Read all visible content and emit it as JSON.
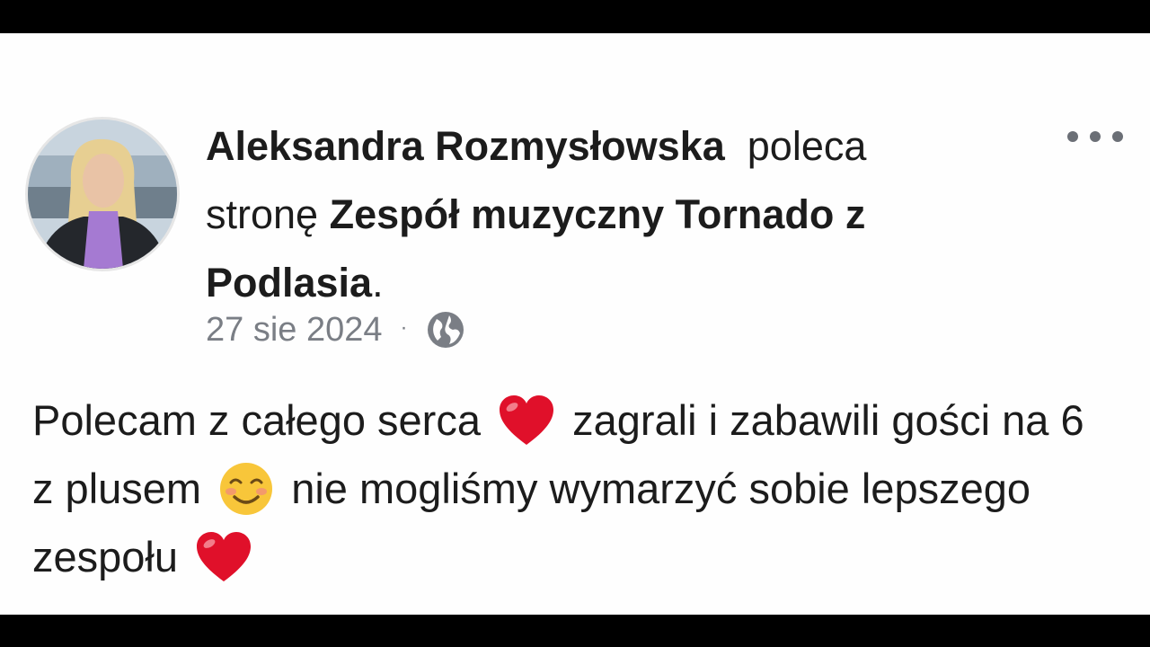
{
  "post": {
    "author": "Aleksandra Rozmysłowska",
    "action_text": "poleca",
    "page_prefix": "stronę",
    "page_name": "Zespół muzyczny Tornado z Podlasia",
    "page_suffix": ".",
    "date": "27 sie 2024",
    "separator": "·",
    "privacy_icon": "globe-icon",
    "more_icon": "more-options-icon",
    "body": {
      "part1": "Polecam z całego serca",
      "emoji1": "red-heart",
      "part2": "zagrali i zabawili gości na 6 z plusem",
      "emoji2": "smiling-face-with-blush",
      "part3": "nie mogliśmy wymarzyć sobie lepszego zespołu",
      "emoji3": "red-heart"
    }
  },
  "colors": {
    "background": "#fefefe",
    "text": "#1c1c1c",
    "meta": "#7a7e85",
    "heart": "#e0102a",
    "letterbox": "#000000"
  }
}
